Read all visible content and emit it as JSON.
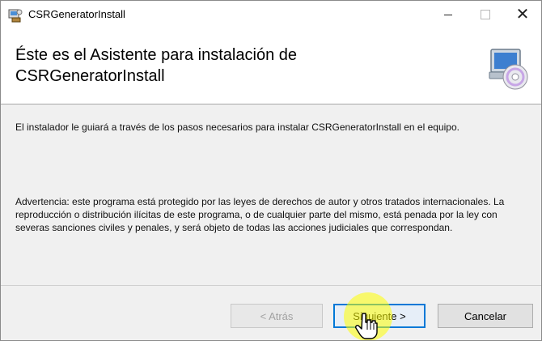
{
  "window": {
    "title": "CSRGeneratorInstall",
    "controls": {
      "minimize_icon": "minimize-icon",
      "maximize_icon": "maximize-icon",
      "close_icon": "close-icon"
    }
  },
  "header": {
    "title": "Éste es el Asistente para instalación de\nCSRGeneratorInstall",
    "icon": "setup-cd-icon"
  },
  "body": {
    "intro": "El instalador le guiará a través de los pasos necesarios para instalar CSRGeneratorInstall en el equipo.",
    "warning": "Advertencia: este programa está protegido por las leyes de derechos de autor y otros tratados internacionales. La reproducción o distribución ilícitas de este programa, o de cualquier parte del mismo, está penada por la ley con severas sanciones civiles y penales, y será objeto de todas las acciones judiciales que correspondan."
  },
  "buttons": {
    "back_label": "< Atrás",
    "next_label": "Siguiente >",
    "cancel_label": "Cancelar",
    "back_enabled": false
  },
  "colors": {
    "focus_border": "#0078d7",
    "cursor_highlight": "#ffff00"
  }
}
